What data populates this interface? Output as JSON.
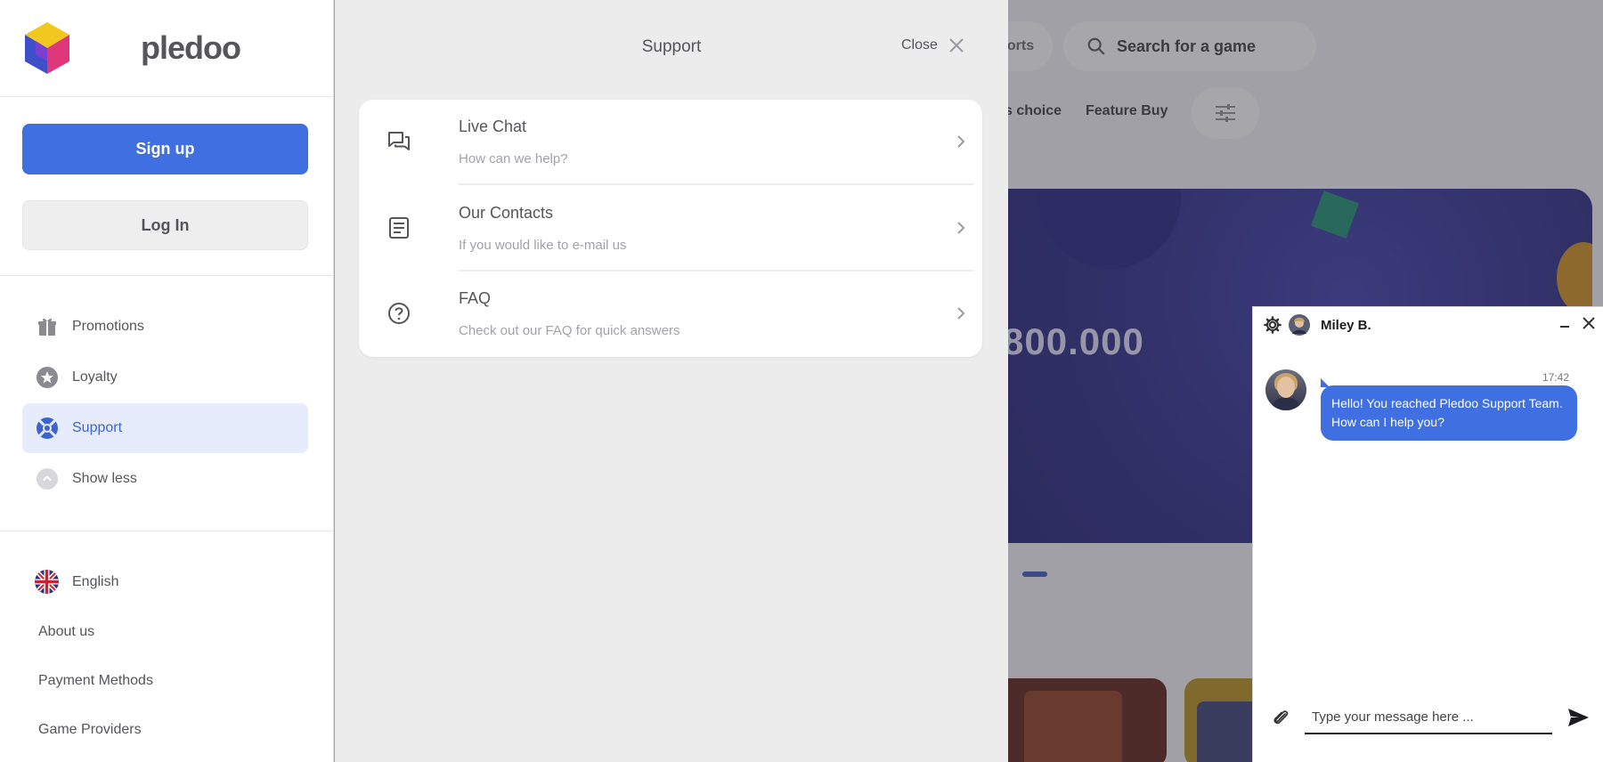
{
  "app": {
    "logo_text": "pledoo"
  },
  "sidebar": {
    "signup_label": "Sign up",
    "login_label": "Log In",
    "nav": [
      {
        "label": "Promotions",
        "icon": "gift-icon"
      },
      {
        "label": "Loyalty",
        "icon": "star-icon"
      },
      {
        "label": "Support",
        "icon": "lifebuoy-icon",
        "active": true
      },
      {
        "label": "Show less",
        "icon": "chevron-up-icon"
      }
    ],
    "language": "English",
    "footer_links": [
      "About us",
      "Payment Methods",
      "Game Providers"
    ]
  },
  "support": {
    "title": "Support",
    "close_label": "Close",
    "items": [
      {
        "title": "Live Chat",
        "subtitle": "How can we help?",
        "icon": "chat-icon"
      },
      {
        "title": "Our Contacts",
        "subtitle": "If you would like to e-mail us",
        "icon": "document-icon"
      },
      {
        "title": "FAQ",
        "subtitle": "Check out our FAQ for quick answers",
        "icon": "help-circle-icon"
      }
    ]
  },
  "background": {
    "search_placeholder": "Search for a game",
    "pill_partial": "orts",
    "filter_left": "s choice",
    "filter_right": "Feature Buy",
    "banner_amount": "800.000"
  },
  "chat": {
    "agent_name": "Miley B.",
    "message_time": "17:42",
    "message_text_line1": "Hello! You reached Pledoo Support Team.",
    "message_text_line2": "How can I help you?",
    "input_placeholder": "Type your message here ..."
  },
  "colors": {
    "accent": "#3f6fe0",
    "active_nav_bg": "#e6ecfc",
    "active_nav_text": "#3d63cf"
  }
}
